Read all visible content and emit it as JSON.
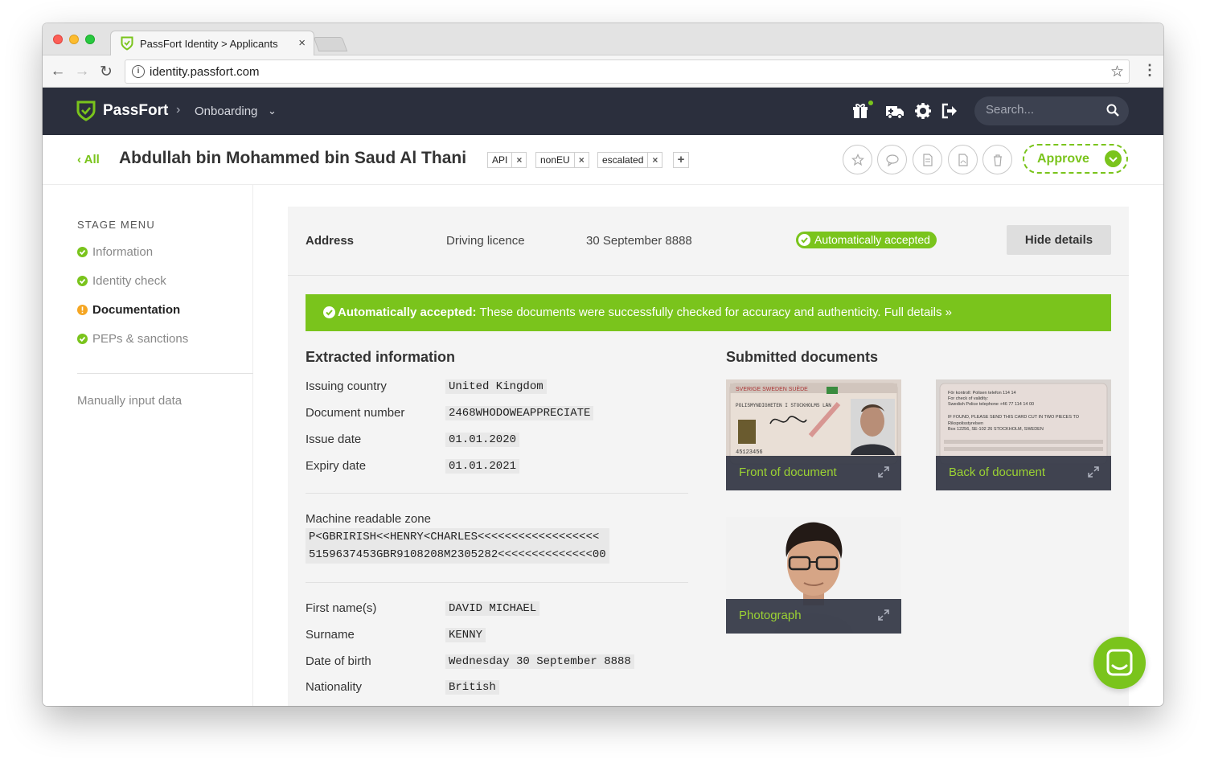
{
  "browser": {
    "tab_title": "PassFort Identity > Applicants",
    "tab_close": "×",
    "url": "identity.passfort.com"
  },
  "header": {
    "brand": "PassFort",
    "crumb_separator": "›",
    "crumb": "Onboarding",
    "search_placeholder": "Search..."
  },
  "applicant": {
    "back_label": "‹ All",
    "name": "Abdullah bin Mohammed bin Saud Al Thani",
    "tags": [
      "API",
      "nonEU",
      "escalated"
    ],
    "approve_label": "Approve"
  },
  "sidebar": {
    "title": "STAGE MENU",
    "items": [
      {
        "label": "Information",
        "status": "done"
      },
      {
        "label": "Identity check",
        "status": "done"
      },
      {
        "label": "Documentation",
        "status": "active"
      },
      {
        "label": "PEPs & sanctions",
        "status": "done"
      }
    ],
    "manual_label": "Manually input data"
  },
  "document_row": {
    "label": "Address",
    "type": "Driving licence",
    "date": "30 September 8888",
    "status": "Automatically accepted",
    "hide_button": "Hide details"
  },
  "banner": {
    "strong": "Automatically accepted:",
    "text": " These documents were successfully checked for accuracy and authenticity. Full details »"
  },
  "extracted": {
    "title": "Extracted information",
    "fields": [
      {
        "label": "Issuing country",
        "value": "United Kingdom"
      },
      {
        "label": "Document number",
        "value": "2468WHODOWEAPPRECIATE"
      },
      {
        "label": "Issue date",
        "value": "01.01.2020"
      },
      {
        "label": "Expiry date",
        "value": "01.01.2021"
      }
    ],
    "mrz_label": "Machine readable zone",
    "mrz_line1": "P<GBRIRISH<<HENRY<CHARLES<<<<<<<<<<<<<<<<<<",
    "mrz_line2": "5159637453GBR9108208M2305282<<<<<<<<<<<<<<00",
    "person": [
      {
        "label": "First name(s)",
        "value": "DAVID MICHAEL"
      },
      {
        "label": "Surname",
        "value": "KENNY"
      },
      {
        "label": "Date of birth",
        "value": "Wednesday 30 September 8888"
      },
      {
        "label": "Nationality",
        "value": "British"
      }
    ]
  },
  "submitted": {
    "title": "Submitted documents",
    "documents": [
      {
        "caption": "Front of document"
      },
      {
        "caption": "Back of document"
      },
      {
        "caption": "Photograph"
      }
    ],
    "front_card": {
      "header": "SVERIGE SWEDEN SUÈDE",
      "line": "POLISMYNDIGHETEN I STOCKHOLMS LÄN",
      "number": "45123456"
    },
    "back_card": {
      "line1": "För kontroll: Polisen telefon 114 14",
      "line2": "For check of validity:",
      "line3": "Swedish Police telephone +46 77 114 14 00",
      "line4": "IF FOUND, PLEASE SEND THIS CARD CUT IN TWO PIECES TO",
      "line5": "Rikspolisstyrelsen",
      "line6": "Box 12256, SE-102 26 STOCKHOLM, SWEDEN"
    }
  },
  "colors": {
    "accent": "#7ac41c",
    "header_bg": "#2b2f3d",
    "warning": "#f5a623"
  }
}
